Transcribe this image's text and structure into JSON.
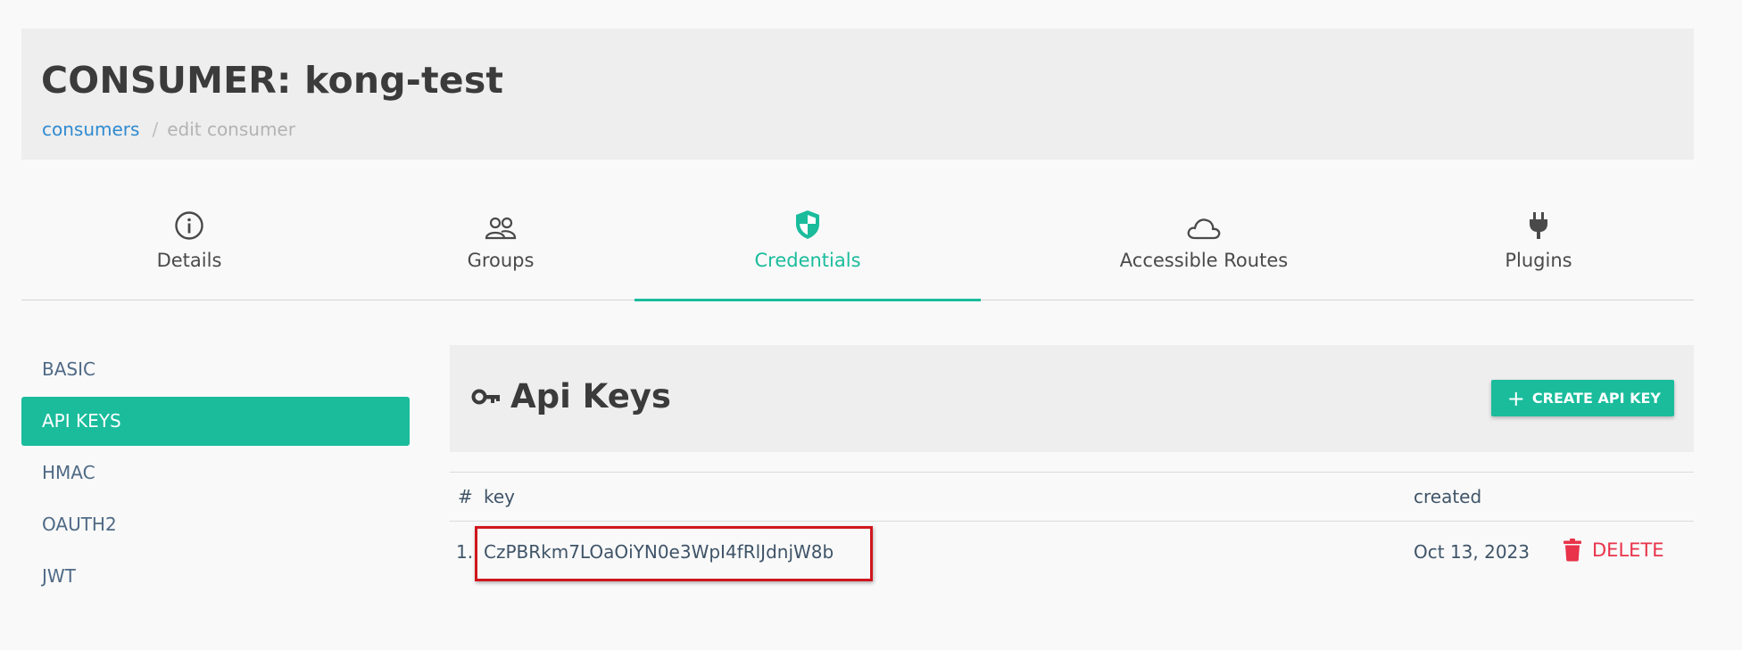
{
  "header": {
    "title": "CONSUMER: kong-test",
    "breadcrumb": {
      "link": "consumers",
      "separator": "/",
      "current": "edit consumer"
    }
  },
  "tabs": [
    {
      "label": "Details",
      "icon": "info-icon"
    },
    {
      "label": "Groups",
      "icon": "users-icon"
    },
    {
      "label": "Credentials",
      "icon": "shield-icon",
      "active": true
    },
    {
      "label": "Accessible Routes",
      "icon": "cloud-icon"
    },
    {
      "label": "Plugins",
      "icon": "plug-icon"
    }
  ],
  "sidenav": {
    "items": [
      {
        "label": "BASIC"
      },
      {
        "label": "API KEYS",
        "active": true
      },
      {
        "label": "HMAC"
      },
      {
        "label": "OAUTH2"
      },
      {
        "label": "JWT"
      }
    ]
  },
  "panel": {
    "title": "Api Keys",
    "icon": "key-icon",
    "create_button": "CREATE API KEY"
  },
  "table": {
    "headers": {
      "index": "#",
      "key": "key",
      "created": "created"
    },
    "rows": [
      {
        "index": "1.",
        "key": "CzPBRkm7LOaOiYN0e3WpI4fRlJdnjW8b",
        "created": "Oct 13, 2023",
        "delete_label": "DELETE"
      }
    ]
  },
  "colors": {
    "accent": "#1abc9c",
    "link": "#2f8ad0",
    "danger": "#e8334a",
    "highlight_box": "#d0161e"
  }
}
